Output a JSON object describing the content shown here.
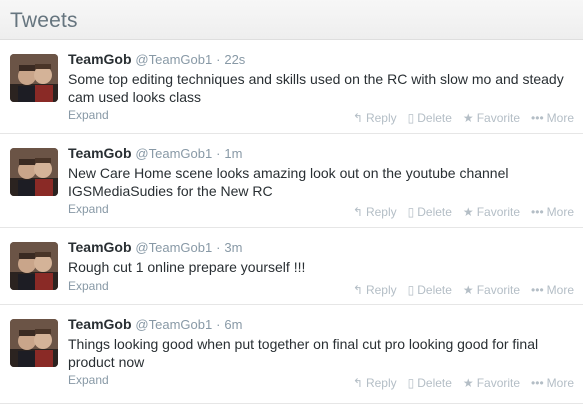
{
  "header": {
    "title": "Tweets"
  },
  "icons": {
    "reply": "reply-icon",
    "delete": "trash-icon",
    "favorite": "star-icon",
    "more": "ellipsis-icon"
  },
  "labels": {
    "expand": "Expand",
    "reply": "Reply",
    "delete": "Delete",
    "favorite": "Favorite",
    "more": "More"
  },
  "colors": {
    "secondary": "#8899a6",
    "action": "#b4bec6",
    "text": "#292f33"
  },
  "tweets": [
    {
      "name": "TeamGob",
      "handle": "@TeamGob1",
      "time": "22s",
      "text": "Some top editing techniques and skills used on the RC with slow mo and steady cam used looks class"
    },
    {
      "name": "TeamGob",
      "handle": "@TeamGob1",
      "time": "1m",
      "text": "New Care Home scene looks amazing look out on the youtube channel IGSMediaSudies for the New RC"
    },
    {
      "name": "TeamGob",
      "handle": "@TeamGob1",
      "time": "3m",
      "text": "Rough cut 1 online prepare yourself !!!"
    },
    {
      "name": "TeamGob",
      "handle": "@TeamGob1",
      "time": "6m",
      "text": "Things looking good when put together on final cut pro looking good for final product now"
    }
  ]
}
